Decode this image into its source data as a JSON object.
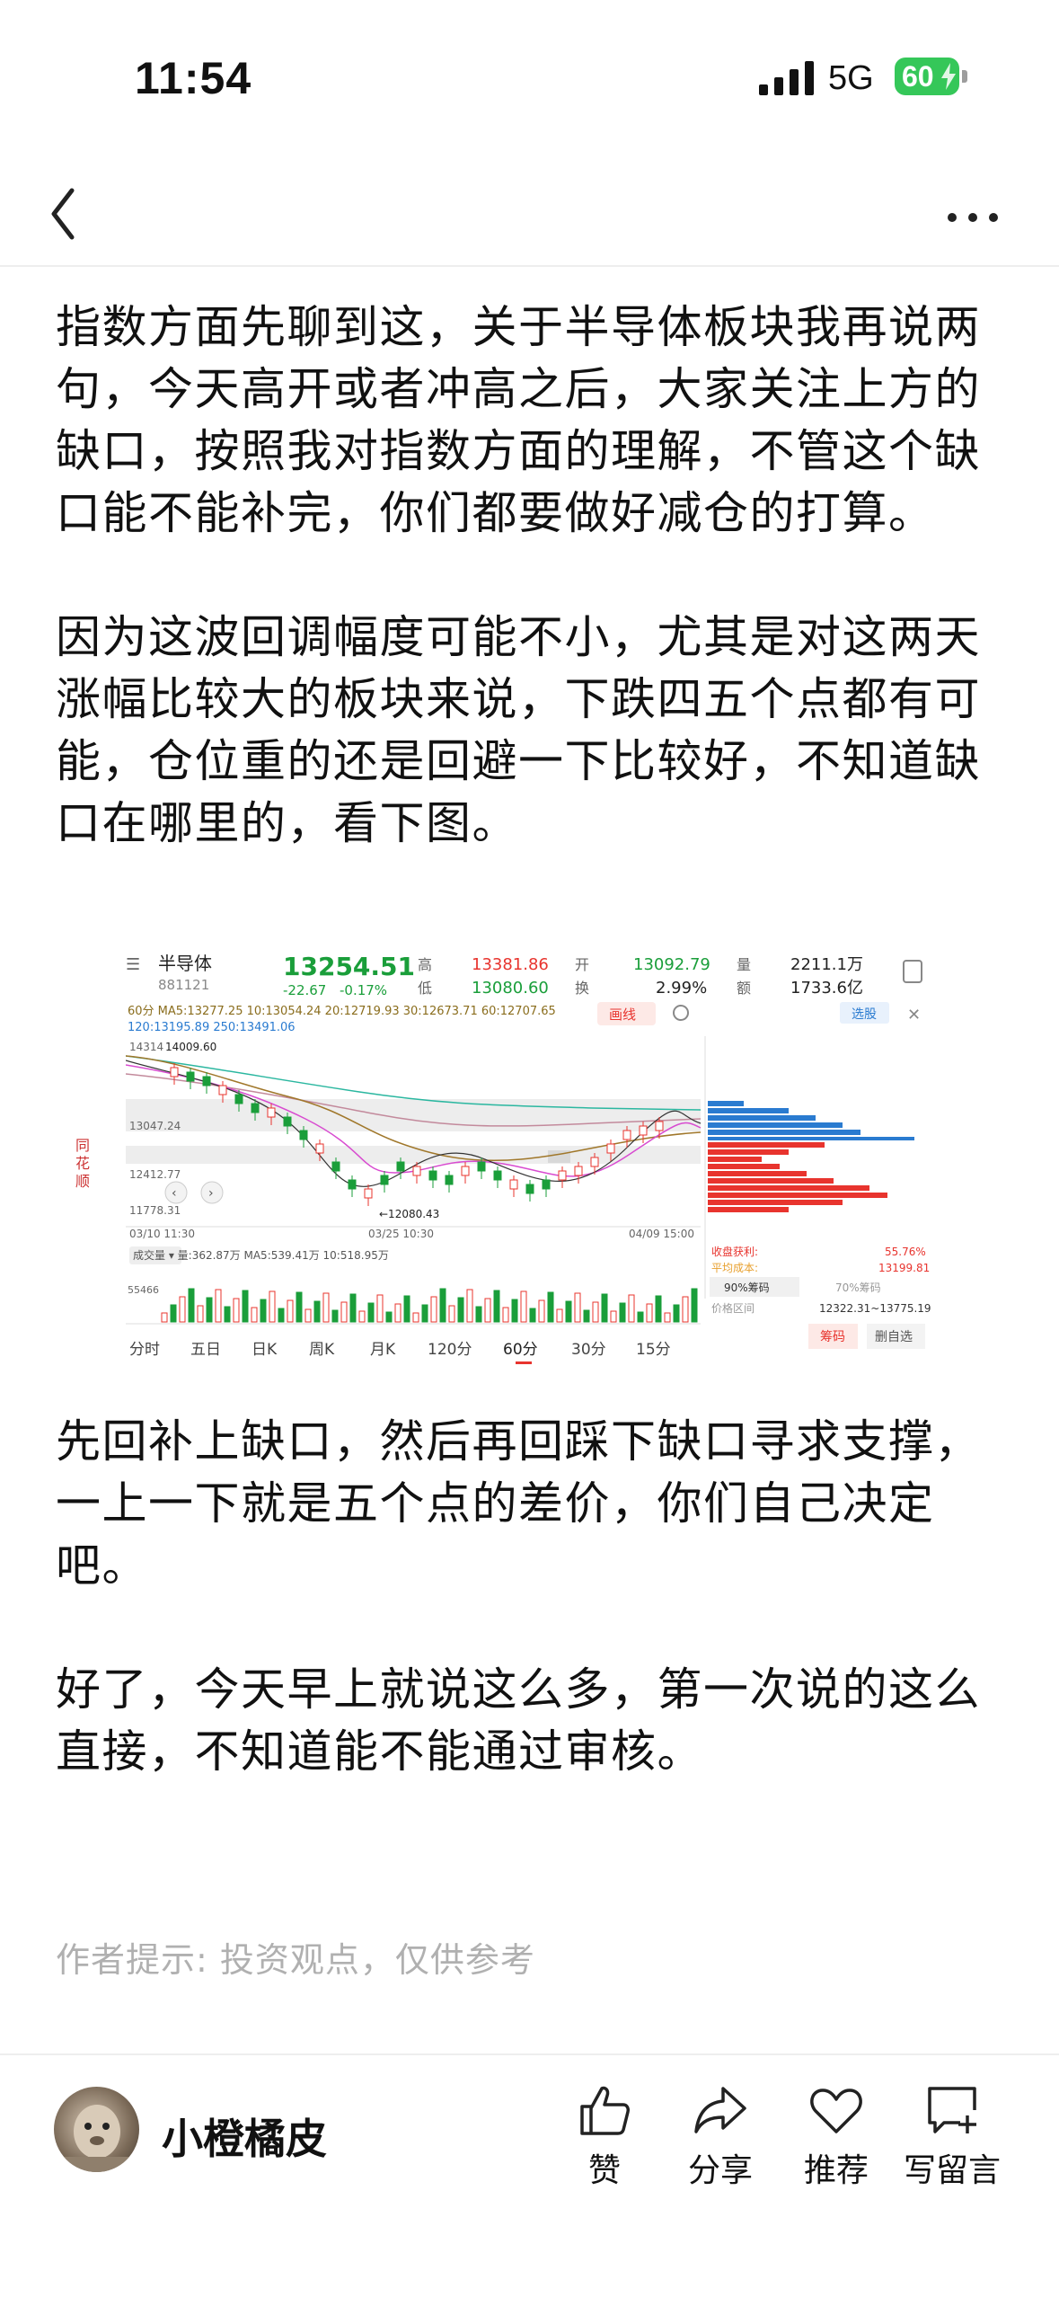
{
  "status_bar": {
    "time": "11:54",
    "network": "5G",
    "battery": "60"
  },
  "article": {
    "paragraphs": [
      "指数方面先聊到这，关于半导体板块我再说两句，今天高开或者冲高之后，大家关注上方的缺口，按照我对指数方面的理解，不管这个缺口能不能补完，你们都要做好减仓的打算。",
      "因为这波回调幅度可能不小，尤其是对这两天涨幅比较大的板块来说，下跌四五个点都有可能，仓位重的还是回避一下比较好，不知道缺口在哪里的，看下图。",
      "先回补上缺口，然后再回踩下缺口寻求支撑，一上一下就是五个点的差价，你们自己决定吧。",
      "好了，今天早上就说这么多，第一次说的这么直接，不知道能不能通过审核。"
    ],
    "tip": "作者提示: 投资观点，仅供参考"
  },
  "stock_image": {
    "name": "半导体",
    "code": "881121",
    "price": "13254.51",
    "change": "-22.67",
    "change_pct": "-0.17%",
    "high_label": "高",
    "high": "13381.86",
    "low_label": "低",
    "low": "13080.60",
    "open_label": "开",
    "open": "13092.79",
    "turnover_label": "换",
    "turnover": "2.99%",
    "volume_label": "量",
    "volume": "2211.1万",
    "amount_label": "额",
    "amount": "1733.6亿",
    "ma_line1": "60分  MA5:13277.25  10:13054.24  20:12719.93  30:12673.71  60:12707.65",
    "ma_line2": "120:13195.89  250:13491.06",
    "draw_btn": "画线",
    "select_btn": "选股",
    "axis_top": "14314",
    "peak_label": "14009.60",
    "axis_mid": "13047.24",
    "axis_low": "12412.77",
    "axis_bottom": "11778.31",
    "trough_label": "←12080.43",
    "date_left": "03/10 11:30",
    "date_mid": "03/25 10:30",
    "date_right": "04/09 15:00",
    "brand": "同花顺",
    "vol_line": "成交量 ▾  量:362.87万  MA5:539.41万  10:518.95万",
    "vol_axis": "55466",
    "chip_profit_label": "收盘获利:",
    "chip_profit": "55.76%",
    "chip_cost_label": "平均成本:",
    "chip_cost": "13199.81",
    "chip_tab1": "90%筹码",
    "chip_tab2": "70%筹码",
    "chip_range_label": "价格区间",
    "chip_range": "12322.31~13775.19",
    "chip_btn1": "筹码",
    "chip_btn2": "删自选",
    "periods": [
      "分时",
      "五日",
      "日K",
      "周K",
      "月K",
      "120分",
      "60分",
      "30分",
      "15分"
    ],
    "active_period": "60分"
  },
  "author": {
    "name": "小橙橘皮"
  },
  "actions": [
    {
      "label": "赞",
      "icon": "thumbs-up-icon"
    },
    {
      "label": "分享",
      "icon": "share-icon"
    },
    {
      "label": "推荐",
      "icon": "heart-icon"
    },
    {
      "label": "写留言",
      "icon": "comment-icon"
    }
  ],
  "colors": {
    "up": "#e8342e",
    "down": "#1a9e3a",
    "tip": "#b0b0b0",
    "battery": "#35c759"
  }
}
